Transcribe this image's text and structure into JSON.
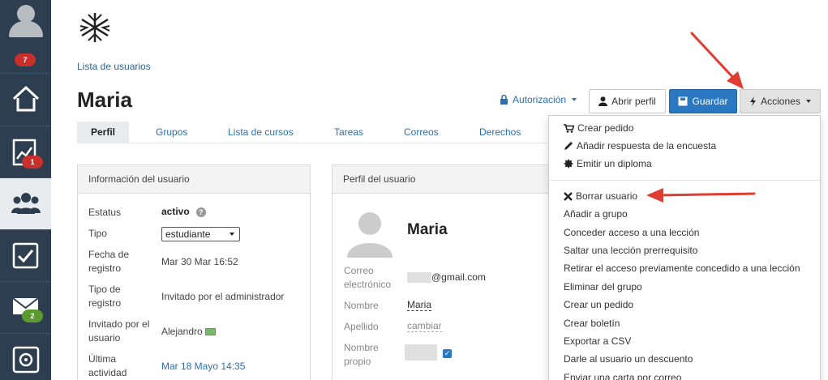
{
  "sidebar": {
    "badges": {
      "profile": "7",
      "reports": "1",
      "messages": "2"
    },
    "items": [
      {
        "name": "home-icon"
      },
      {
        "name": "reports-icon"
      },
      {
        "name": "users-icon"
      },
      {
        "name": "tasks-icon"
      },
      {
        "name": "mail-icon"
      },
      {
        "name": "vault-icon"
      }
    ]
  },
  "breadcrumb": "Lista de usuarios",
  "page_title": "Maria",
  "toolbar": {
    "auth_label": "Autorización",
    "open_profile_label": "Abrir perfil",
    "save_label": "Guardar",
    "actions_label": "Acciones"
  },
  "tabs": [
    "Perfil",
    "Grupos",
    "Lista de cursos",
    "Tareas",
    "Correos",
    "Derechos"
  ],
  "user_info": {
    "title": "Información del usuario",
    "status_label": "Estatus",
    "status_value": "activo",
    "type_label": "Tipo",
    "type_value": "estudiante",
    "reg_date_label": "Fecha de registro",
    "reg_date_value": "Mar 30 Mar 16:52",
    "reg_type_label": "Tipo de registro",
    "reg_type_value": "Invitado por el administrador",
    "invited_by_label": "Invitado por el usuario",
    "invited_by_value": "Alejandro",
    "last_activity_label": "Última actividad",
    "last_activity_value": "Mar 18 Mayo 14:35"
  },
  "user_profile": {
    "title": "Perfil del usuario",
    "name": "Maria",
    "email_label": "Correo electrónico",
    "email_suffix": "@gmail.com",
    "first_name_label": "Nombre",
    "first_name_value": "Maria",
    "last_name_label": "Apellido",
    "last_name_value": "cambiar",
    "own_name_label": "Nombre propio"
  },
  "actions_menu": {
    "items": [
      "Crear pedido",
      "Añadir respuesta de la encuesta",
      "Emitir un diploma",
      "Borrar usuario",
      "Añadir a grupo",
      "Conceder acceso a una lección",
      "Saltar una lección prerrequisito",
      "Retirar el acceso previamente concedido a una lección",
      "Eliminar del grupo",
      "Crear un pedido",
      "Crear boletín",
      "Exportar a CSV",
      "Darle al usuario un descuento",
      "Enviar una carta por correo"
    ]
  },
  "colors": {
    "sidebar": "#2c3e50",
    "accent": "#2a78c2",
    "annotation_arrow": "#e03c31"
  }
}
